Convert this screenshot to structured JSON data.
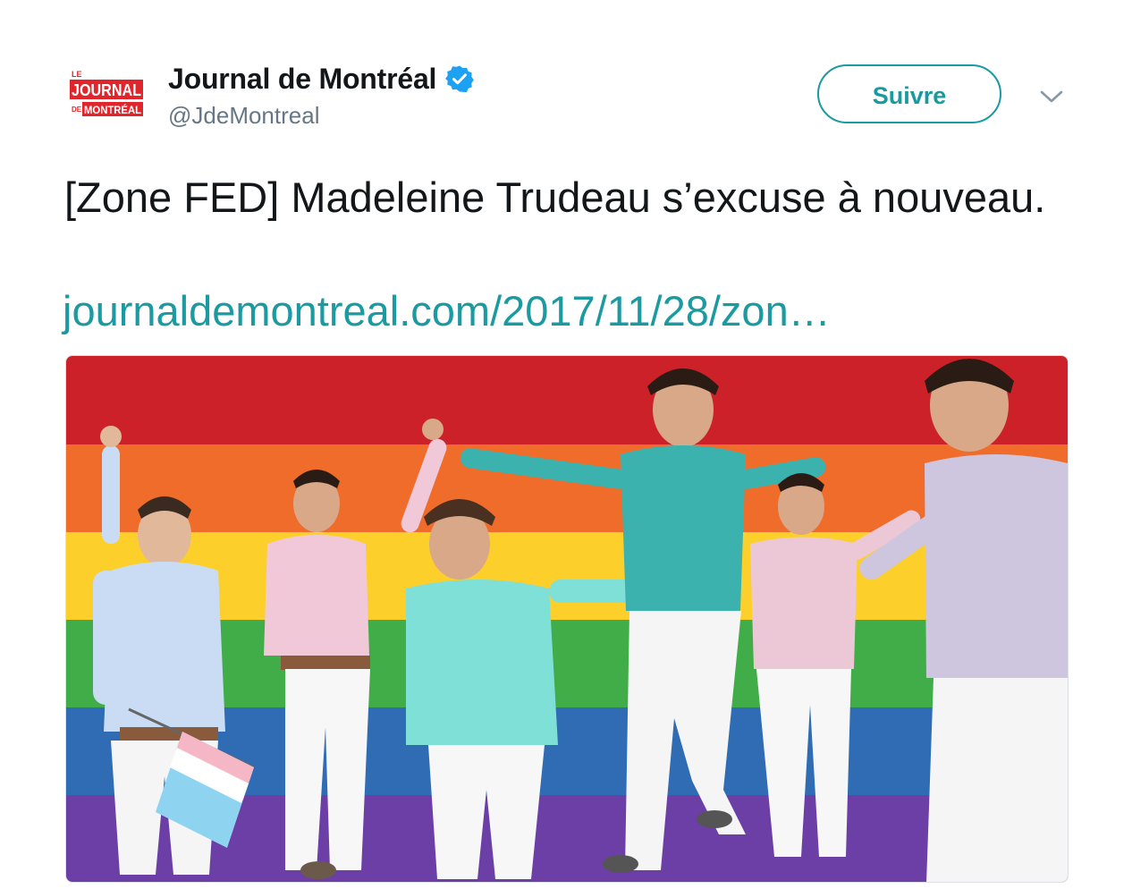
{
  "account": {
    "display_name": "Journal de Montréal",
    "handle": "@JdeMontreal",
    "verified": true,
    "verified_icon": "verified-badge-icon",
    "avatar_logo": {
      "line1": "LE",
      "line2": "JOURNAL",
      "line3": "DE",
      "line4": "MONTRÉAL",
      "color": "#e0262c"
    }
  },
  "follow_button": {
    "label": "Suivre",
    "color": "#1a9aa0"
  },
  "menu_icon": "chevron-down-icon",
  "tweet": {
    "text": "[Zone FED] Madeleine Trudeau s’excuse à nouveau.",
    "link": "journaldemontreal.com/2017/11/28/zon…",
    "link_color": "#1b9aa2"
  },
  "media": {
    "type": "photo",
    "flag_stripes": [
      "#cc2128",
      "#ef6c2b",
      "#fccf2b",
      "#41ad49",
      "#2f6cb4",
      "#6b3fa6"
    ]
  }
}
